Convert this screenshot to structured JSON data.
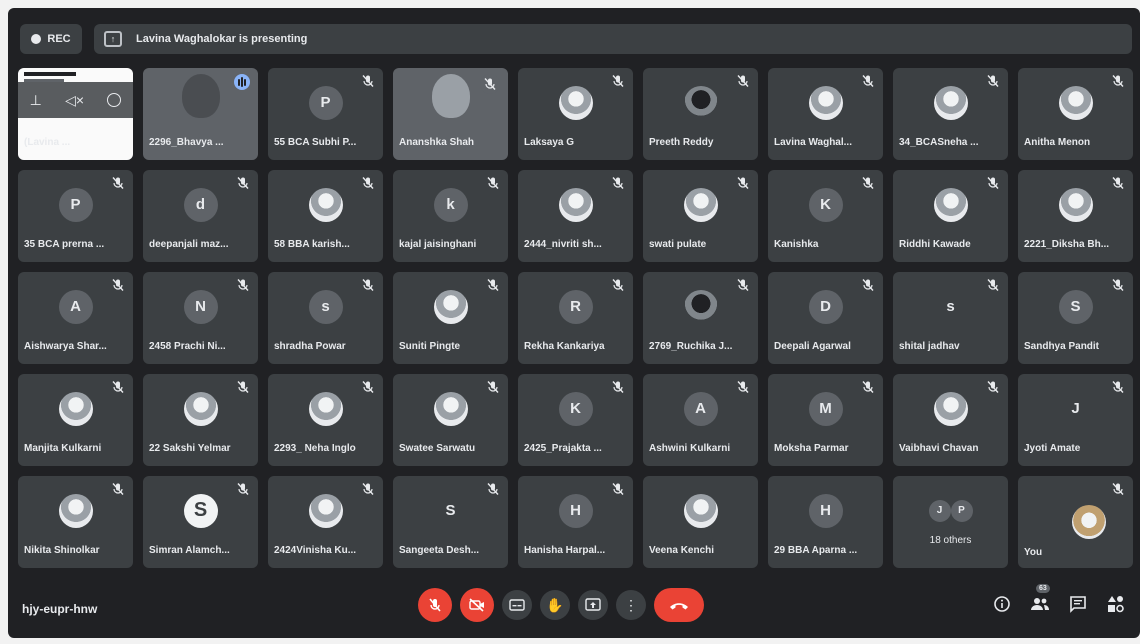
{
  "recording": {
    "label": "REC"
  },
  "presentation": {
    "text": "Lavina Waghalokar is presenting"
  },
  "tiles": [
    {
      "name": "(Lavina ...",
      "kind": "share",
      "muted": false
    },
    {
      "name": "2296_Bhavya ...",
      "kind": "video",
      "muted": false,
      "speaking": true
    },
    {
      "name": "55 BCA Subhi P...",
      "kind": "letter",
      "initial": "P",
      "muted": true
    },
    {
      "name": "Ananshka Shah",
      "kind": "video",
      "muted": true
    },
    {
      "name": "Laksaya G",
      "kind": "photo",
      "muted": true
    },
    {
      "name": "Preeth Reddy",
      "kind": "dark",
      "muted": true
    },
    {
      "name": "Lavina Waghal...",
      "kind": "photo",
      "muted": true
    },
    {
      "name": "34_BCASneha ...",
      "kind": "photo",
      "muted": true
    },
    {
      "name": "Anitha Menon",
      "kind": "photo",
      "muted": true
    },
    {
      "name": "35 BCA prerna ...",
      "kind": "letter",
      "initial": "P",
      "muted": true
    },
    {
      "name": "deepanjali maz...",
      "kind": "letter",
      "initial": "d",
      "muted": true
    },
    {
      "name": "58 BBA karish...",
      "kind": "photo",
      "muted": true
    },
    {
      "name": "kajal jaisinghani",
      "kind": "letter",
      "initial": "k",
      "muted": true
    },
    {
      "name": "2444_nivriti sh...",
      "kind": "photo",
      "muted": true
    },
    {
      "name": "swati pulate",
      "kind": "photo",
      "muted": true
    },
    {
      "name": "Kanishka",
      "kind": "letter",
      "initial": "K",
      "muted": true
    },
    {
      "name": "Riddhi Kawade",
      "kind": "photo",
      "muted": true
    },
    {
      "name": "2221_Diksha Bh...",
      "kind": "photo",
      "muted": true
    },
    {
      "name": "Aishwarya Shar...",
      "kind": "letter",
      "initial": "A",
      "muted": true
    },
    {
      "name": "2458 Prachi Ni...",
      "kind": "letter",
      "initial": "N",
      "muted": true
    },
    {
      "name": "shradha Powar",
      "kind": "letter",
      "initial": "s",
      "muted": true
    },
    {
      "name": "Suniti Pingte",
      "kind": "photo",
      "muted": true
    },
    {
      "name": "Rekha Kankariya",
      "kind": "letter",
      "initial": "R",
      "muted": true
    },
    {
      "name": "2769_Ruchika J...",
      "kind": "dark",
      "muted": true
    },
    {
      "name": "Deepali Agarwal",
      "kind": "letter",
      "initial": "D",
      "muted": true
    },
    {
      "name": "shital jadhav",
      "kind": "plainletter",
      "initial": "s",
      "muted": true
    },
    {
      "name": "Sandhya Pandit",
      "kind": "letter",
      "initial": "S",
      "muted": true
    },
    {
      "name": "Manjita Kulkarni",
      "kind": "photo",
      "muted": true
    },
    {
      "name": "22 Sakshi Yelmar",
      "kind": "photo",
      "muted": true
    },
    {
      "name": "2293_ Neha Inglo",
      "kind": "photo",
      "muted": true
    },
    {
      "name": "Swatee Sarwatu",
      "kind": "photo",
      "muted": true
    },
    {
      "name": "2425_Prajakta ...",
      "kind": "letter",
      "initial": "K",
      "muted": true
    },
    {
      "name": "Ashwini Kulkarni",
      "kind": "letter",
      "initial": "A",
      "muted": true
    },
    {
      "name": "Moksha Parmar",
      "kind": "letter",
      "initial": "M",
      "muted": true
    },
    {
      "name": "Vaibhavi Chavan",
      "kind": "photo",
      "muted": true
    },
    {
      "name": "Jyoti Amate",
      "kind": "plainletter",
      "initial": "J",
      "muted": true
    },
    {
      "name": "Nikita Shinolkar",
      "kind": "photo",
      "muted": true
    },
    {
      "name": "Simran Alamch...",
      "kind": "whiteletter",
      "initial": "S",
      "muted": true
    },
    {
      "name": "2424Vinisha Ku...",
      "kind": "photo",
      "muted": true
    },
    {
      "name": "Sangeeta Desh...",
      "kind": "plainletter",
      "initial": "S",
      "muted": true
    },
    {
      "name": "Hanisha Harpal...",
      "kind": "letter",
      "initial": "H",
      "muted": true
    },
    {
      "name": "Veena Kenchi",
      "kind": "photo",
      "muted": false
    },
    {
      "name": "29 BBA Aparna ...",
      "kind": "letter",
      "initial": "H",
      "muted": false
    },
    {
      "name": "18 others",
      "kind": "others",
      "initials": [
        "J",
        "P"
      ],
      "muted": false
    },
    {
      "name": "You",
      "kind": "self",
      "muted": true
    }
  ],
  "bottom": {
    "meeting_code": "hjy-eupr-hnw",
    "participants_count": "63"
  }
}
